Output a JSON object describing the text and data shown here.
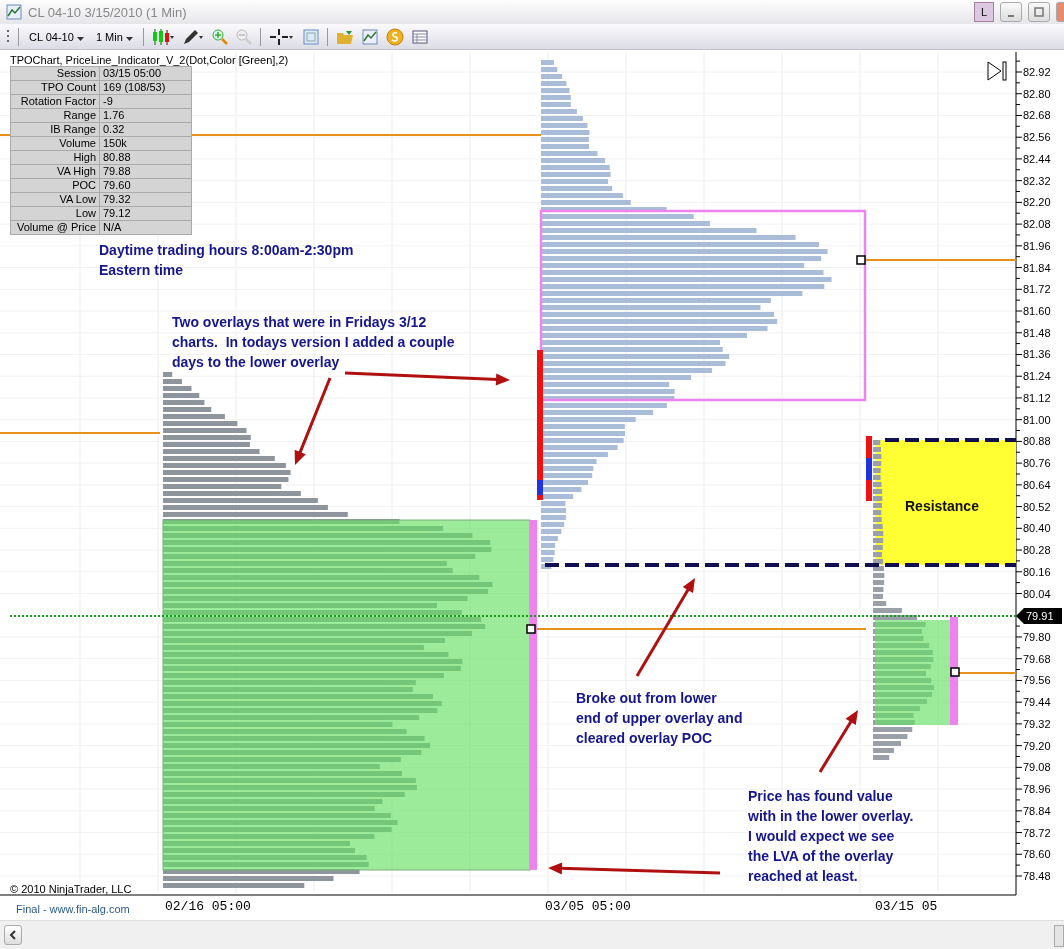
{
  "window": {
    "title": "CL 04-10  3/15/2010 (1 Min)",
    "badge": "L"
  },
  "toolbar": {
    "instrument": "CL 04-10",
    "interval": "1 Min"
  },
  "indicator_label": "TPOChart, PriceLine_Indicator_V_2(Dot,Color [Green],2)",
  "stats": [
    {
      "label": "Session",
      "value": "03/15 05:00"
    },
    {
      "label": "TPO Count",
      "value": "169 (108/53)"
    },
    {
      "label": "Rotation Factor",
      "value": "-9"
    },
    {
      "label": "Range",
      "value": "1.76"
    },
    {
      "label": "IB Range",
      "value": "0.32"
    },
    {
      "label": "Volume",
      "value": "150k"
    },
    {
      "label": "High",
      "value": "80.88"
    },
    {
      "label": "VA High",
      "value": "79.88"
    },
    {
      "label": "POC",
      "value": "79.60"
    },
    {
      "label": "VA Low",
      "value": "79.32"
    },
    {
      "label": "Low",
      "value": "79.12"
    },
    {
      "label": "Volume @ Price",
      "value": "N/A"
    }
  ],
  "annotations": [
    {
      "text": "Daytime trading hours 8:00am-2:30pm\nEastern time"
    },
    {
      "text": "Two overlays that were in Fridays 3/12\ncharts.  In todays version I added a couple\ndays to the lower overlay"
    },
    {
      "text": "Broke out from lower\nend of upper overlay and\ncleared overlay POC"
    },
    {
      "text": "Price has found value\nwith in the lower overlay.\nI would expect we see\nthe LVA of the overlay\nreached at least."
    }
  ],
  "resistance_label": "Resistance",
  "price_axis": {
    "labels": [
      "82.92",
      "82.80",
      "82.68",
      "82.56",
      "82.44",
      "82.32",
      "82.20",
      "82.08",
      "81.96",
      "81.84",
      "81.72",
      "81.60",
      "81.48",
      "81.36",
      "81.24",
      "81.12",
      "81.00",
      "80.88",
      "80.76",
      "80.64",
      "80.52",
      "80.40",
      "80.28",
      "80.16",
      "80.04",
      "79.80",
      "79.68",
      "79.56",
      "79.44",
      "79.32",
      "79.20",
      "79.08",
      "78.96",
      "78.84",
      "78.72",
      "78.60",
      "78.48"
    ],
    "current_price": "79.91"
  },
  "time_axis": [
    "02/16 05:00",
    "03/05 05:00",
    "03/15 05"
  ],
  "copyright": "© 2010 NinjaTrader, LLC",
  "footer_link": "Final - www.fin-alg.com"
}
